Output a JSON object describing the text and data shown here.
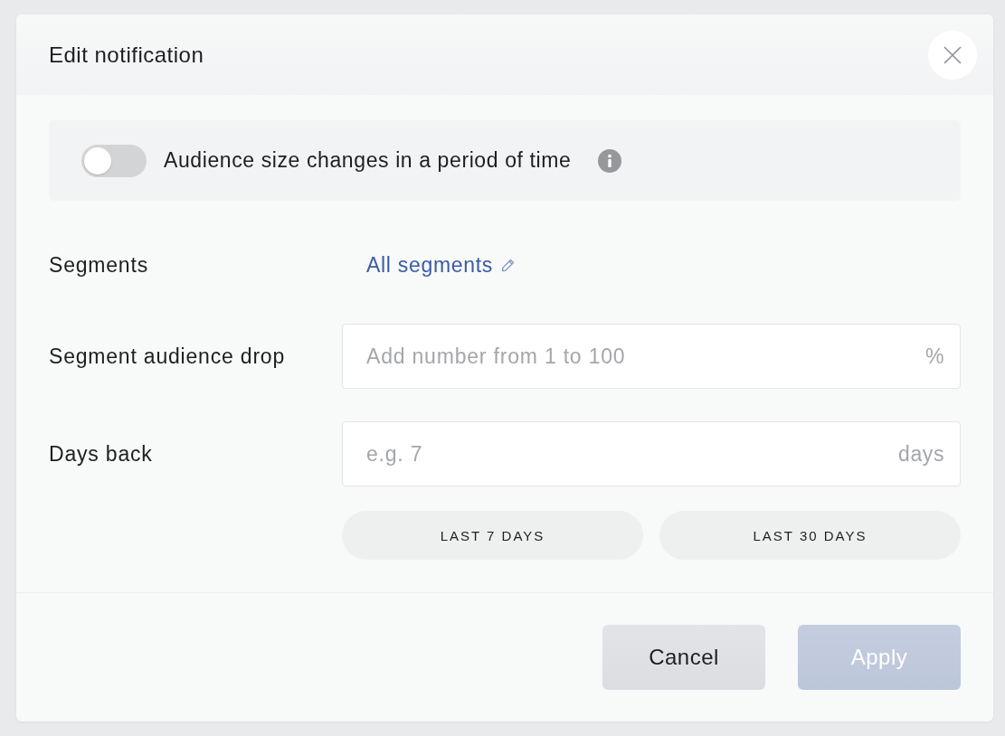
{
  "dialog": {
    "title": "Edit notification"
  },
  "toggle": {
    "label": "Audience size changes in a period of time",
    "on": false
  },
  "fields": [
    {
      "kind": "link",
      "label": "Segments",
      "value": "All segments"
    },
    {
      "kind": "input",
      "label": "Segment audience drop",
      "placeholder": "Add number from 1 to 100",
      "suffix": "%"
    },
    {
      "kind": "input",
      "label": "Days back",
      "placeholder": "e.g. 7",
      "suffix": "days"
    }
  ],
  "presets": [
    "LAST 7 DAYS",
    "LAST 30 DAYS"
  ],
  "buttons": [
    {
      "label": "Cancel",
      "kind": "secondary",
      "disabled": false
    },
    {
      "label": "Apply",
      "kind": "primary",
      "disabled": true
    }
  ]
}
